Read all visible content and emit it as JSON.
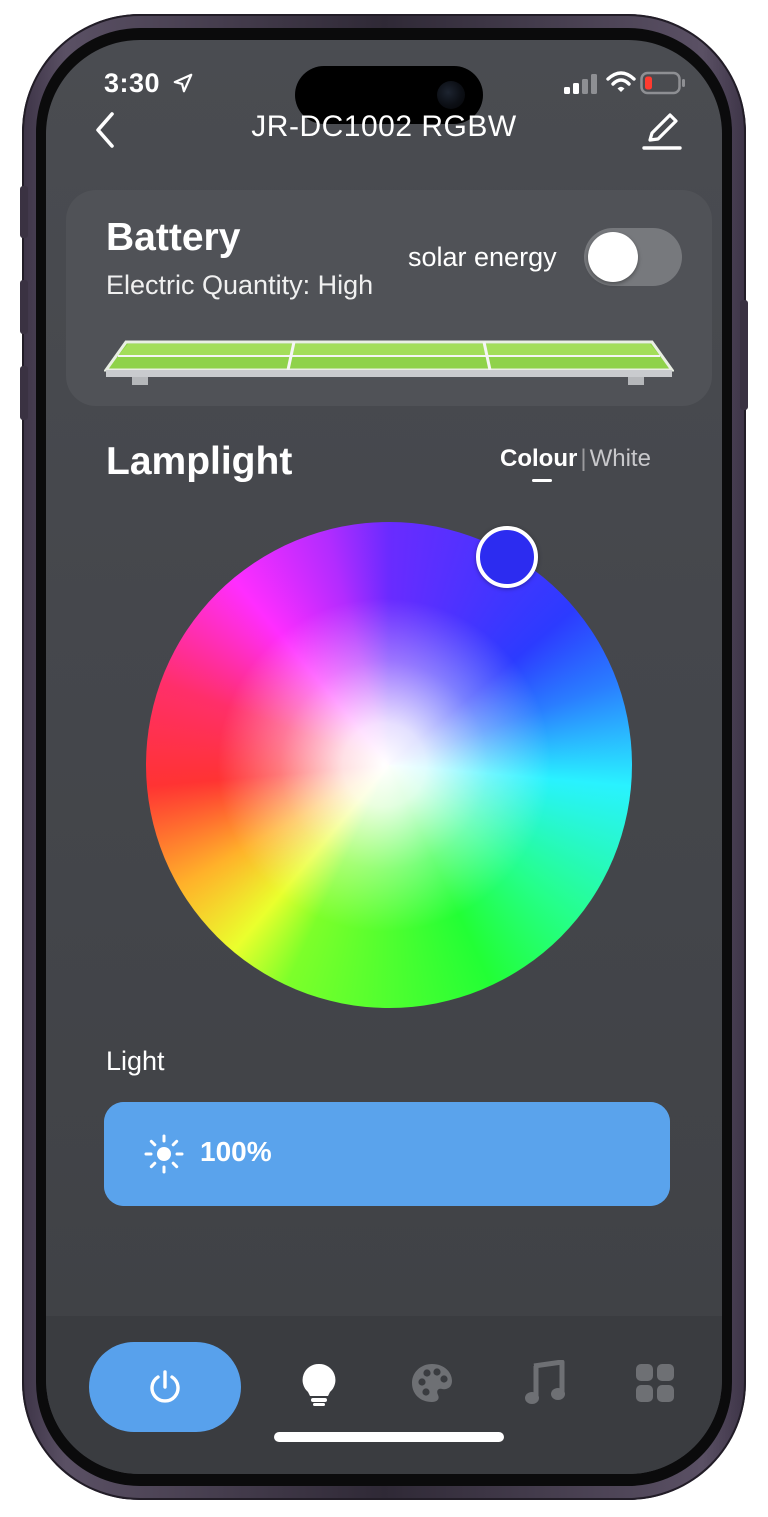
{
  "status_bar": {
    "time": "3:30"
  },
  "header": {
    "title": "JR-DC1002 RGBW"
  },
  "battery": {
    "title": "Battery",
    "subtitle": "Electric Quantity: High",
    "solar_label": "solar energy",
    "solar_enabled": false
  },
  "lamplight": {
    "title": "Lamplight",
    "mode_colour": "Colour",
    "mode_separator": "|",
    "mode_white": "White",
    "selected_mode": "Colour",
    "selected_color": "#2c2cf0"
  },
  "light": {
    "label": "Light",
    "brightness_text": "100%",
    "brightness_value": 1.0
  },
  "tab_bar": {
    "tabs": [
      {
        "icon": "power-icon",
        "selected": true
      },
      {
        "icon": "bulb-icon",
        "selected": false
      },
      {
        "icon": "palette-icon",
        "selected": false
      },
      {
        "icon": "music-icon",
        "selected": false
      },
      {
        "icon": "grid-icon",
        "selected": false
      }
    ]
  },
  "colors": {
    "accent": "#58a1ec",
    "background": "#45474c",
    "card": "#505257"
  }
}
